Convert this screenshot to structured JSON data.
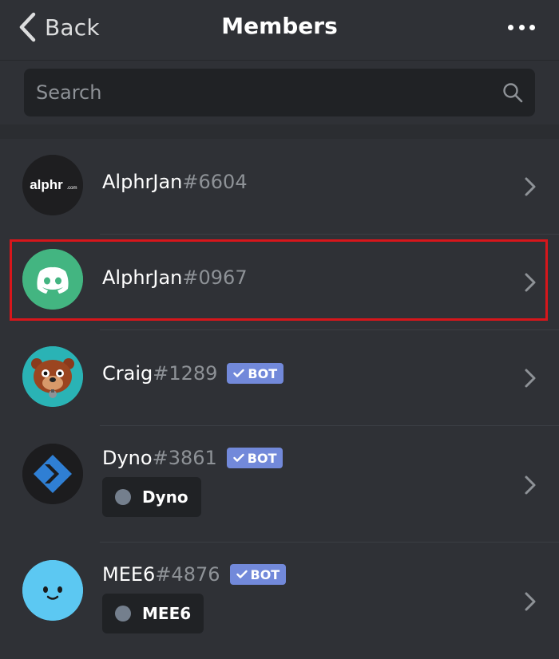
{
  "header": {
    "back_label": "Back",
    "title": "Members",
    "more_icon": "more-horizontal-icon"
  },
  "search": {
    "placeholder": "Search",
    "value": ""
  },
  "colors": {
    "background": "#2f3136",
    "search_bg": "#202225",
    "bot_tag": "#7289da",
    "highlight": "#d7161b",
    "discriminator": "#8e9297"
  },
  "members": [
    {
      "name": "AlphrJan",
      "discriminator": "#6604",
      "avatar": "alphr-logo-avatar",
      "avatar_text": "alphr",
      "avatar_sub": ".com"
    },
    {
      "name": "AlphrJan",
      "discriminator": "#0967",
      "avatar": "discord-logo-avatar",
      "highlighted": true
    },
    {
      "name": "Craig",
      "discriminator": "#1289",
      "avatar": "craig-bear-avatar",
      "bot": true,
      "bot_label": "BOT"
    },
    {
      "name": "Dyno",
      "discriminator": "#3861",
      "avatar": "dyno-logo-avatar",
      "bot": true,
      "bot_label": "BOT",
      "role": "Dyno"
    },
    {
      "name": "MEE6",
      "discriminator": "#4876",
      "avatar": "mee6-face-avatar",
      "bot": true,
      "bot_label": "BOT",
      "role": "MEE6"
    }
  ]
}
